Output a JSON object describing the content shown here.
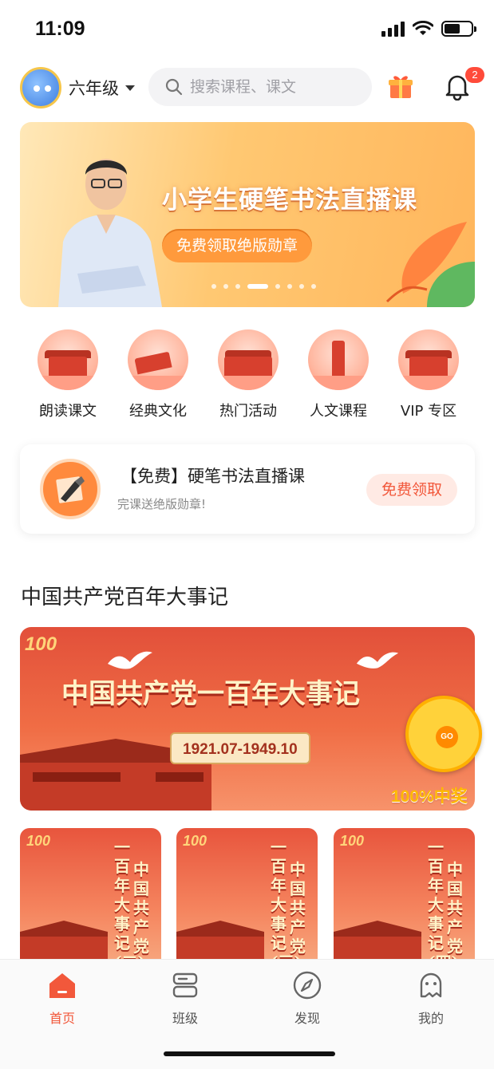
{
  "status_bar": {
    "time": "11:09"
  },
  "header": {
    "grade": "六年级",
    "search_placeholder": "搜索课程、课文",
    "notification_count": "2"
  },
  "banner": {
    "title": "小学生硬笔书法直播课",
    "pill": "免费领取绝版勋章",
    "slide_count": 8,
    "active_slide": 3
  },
  "categories": [
    {
      "label": "朗读课文",
      "icon": "pavilion-icon"
    },
    {
      "label": "经典文化",
      "icon": "scroll-icon"
    },
    {
      "label": "热门活动",
      "icon": "gate-tower-icon"
    },
    {
      "label": "人文课程",
      "icon": "pagoda-icon"
    },
    {
      "label": "VIP 专区",
      "icon": "palace-icon"
    }
  ],
  "promo": {
    "title": "【免费】硬笔书法直播课",
    "subtitle": "完课送绝版勋章!",
    "button": "免费领取",
    "icon": "fountain-pen-icon"
  },
  "section": {
    "title": "中国共产党百年大事记"
  },
  "feature_banner": {
    "logo": "100",
    "title": "中国共产党一百年大事记",
    "date_range": "1921.07-1949.10",
    "prize_label": "100%中奖",
    "wheel_label": "GO"
  },
  "thumbnails": [
    {
      "logo": "100",
      "line1": "一百年大事记(二)",
      "line2": "中国共产党"
    },
    {
      "logo": "100",
      "line1": "一百年大事记(三)",
      "line2": "中国共产党"
    },
    {
      "logo": "100",
      "line1": "一百年大事记(四)",
      "line2": "中国共产党"
    }
  ],
  "tabbar": {
    "tabs": [
      {
        "label": "首页",
        "icon": "home-icon",
        "active": true
      },
      {
        "label": "班级",
        "icon": "class-icon",
        "active": false
      },
      {
        "label": "发现",
        "icon": "compass-icon",
        "active": false
      },
      {
        "label": "我的",
        "icon": "profile-icon",
        "active": false
      }
    ]
  },
  "colors": {
    "accent": "#f2583b",
    "banner_orange": "#ffb65c",
    "party_red": "#e2503a",
    "prize_gold": "#ffb800"
  }
}
